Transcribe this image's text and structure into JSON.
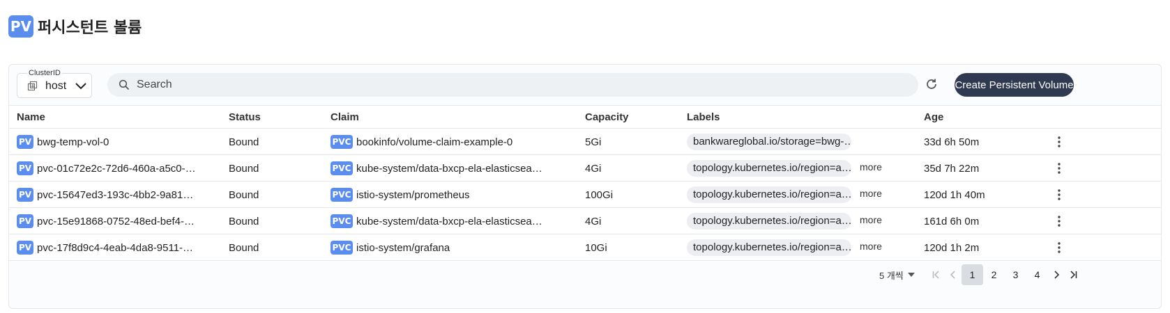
{
  "header": {
    "logo_text": "PV",
    "title": "퍼시스턴트 볼륨"
  },
  "toolbar": {
    "cluster_label": "ClusterID",
    "cluster_value": "host",
    "search_placeholder": "Search",
    "create_label": "Create Persistent Volume"
  },
  "table": {
    "columns": [
      "Name",
      "Status",
      "Claim",
      "Capacity",
      "Labels",
      "Age"
    ],
    "name_badge": "PV",
    "claim_badge": "PVC",
    "more_label": "more",
    "rows": [
      {
        "name": "bwg-temp-vol-0",
        "status": "Bound",
        "claim": "bookinfo/volume-claim-example-0",
        "capacity": "5Gi",
        "label": "bankwareglobal.io/storage=bwg-…",
        "more": false,
        "age": "33d 6h 50m"
      },
      {
        "name": "pvc-01c72e2c-72d6-460a-a5c0-…",
        "status": "Bound",
        "claim": "kube-system/data-bxcp-ela-elasticsea…",
        "capacity": "4Gi",
        "label": "topology.kubernetes.io/region=a…",
        "more": true,
        "age": "35d 7h 22m"
      },
      {
        "name": "pvc-15647ed3-193c-4bb2-9a81…",
        "status": "Bound",
        "claim": "istio-system/prometheus",
        "capacity": "100Gi",
        "label": "topology.kubernetes.io/region=a…",
        "more": true,
        "age": "120d 1h 40m"
      },
      {
        "name": "pvc-15e91868-0752-48ed-bef4-…",
        "status": "Bound",
        "claim": "kube-system/data-bxcp-ela-elasticsea…",
        "capacity": "4Gi",
        "label": "topology.kubernetes.io/region=a…",
        "more": true,
        "age": "161d 6h 0m"
      },
      {
        "name": "pvc-17f8d9c4-4eab-4da8-9511-…",
        "status": "Bound",
        "claim": "istio-system/grafana",
        "capacity": "10Gi",
        "label": "topology.kubernetes.io/region=a…",
        "more": true,
        "age": "120d 1h 2m"
      }
    ]
  },
  "pagination": {
    "rows_per_page": "5 개씩",
    "pages": [
      "1",
      "2",
      "3",
      "4"
    ],
    "current_page": "1"
  },
  "icons": {
    "cluster": "cluster-icon",
    "search": "search-icon",
    "refresh": "refresh-icon",
    "row_menu": "kebab-menu-icon",
    "first_page": "first-page-icon",
    "prev_page": "prev-page-icon",
    "next_page": "next-page-icon",
    "last_page": "last-page-icon"
  },
  "colors": {
    "badge": "#5b8def",
    "primary_button": "#2f3a52",
    "active_page": "#d9dce0"
  }
}
